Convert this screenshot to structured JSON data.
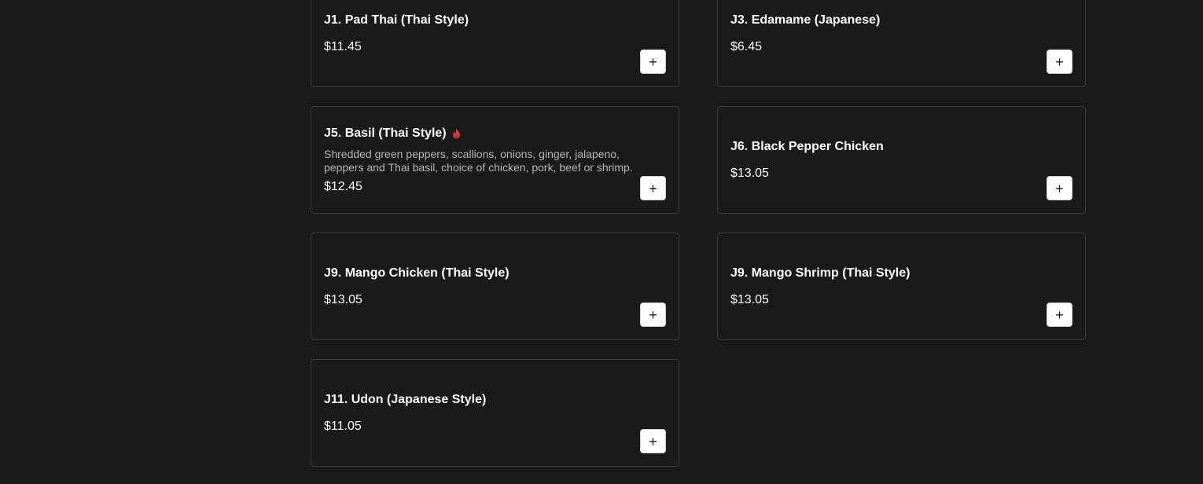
{
  "menu": {
    "items": [
      {
        "name": "J1. Pad Thai (Thai Style)",
        "price": "$11.45",
        "add_label": "+"
      },
      {
        "name": "J3. Edamame (Japanese)",
        "price": "$6.45",
        "add_label": "+"
      },
      {
        "name": "J5. Basil (Thai Style)",
        "spicy_icon": "flame-icon",
        "description": "Shredded green peppers, scallions, onions, ginger, jalapeno, peppers and Thai basil, choice of chicken, pork, beef or shrimp.",
        "price": "$12.45",
        "add_label": "+"
      },
      {
        "name": "J6. Black Pepper Chicken",
        "price": "$13.05",
        "add_label": "+"
      },
      {
        "name": "J9. Mango Chicken (Thai Style)",
        "price": "$13.05",
        "add_label": "+"
      },
      {
        "name": "J9. Mango Shrimp (Thai Style)",
        "price": "$13.05",
        "add_label": "+"
      },
      {
        "name": "J11. Udon (Japanese Style)",
        "price": "$11.05",
        "add_label": "+"
      }
    ]
  },
  "colors": {
    "background": "#1a1a1a",
    "card_border": "#3c3c3c",
    "spicy": "#e03a3a"
  }
}
